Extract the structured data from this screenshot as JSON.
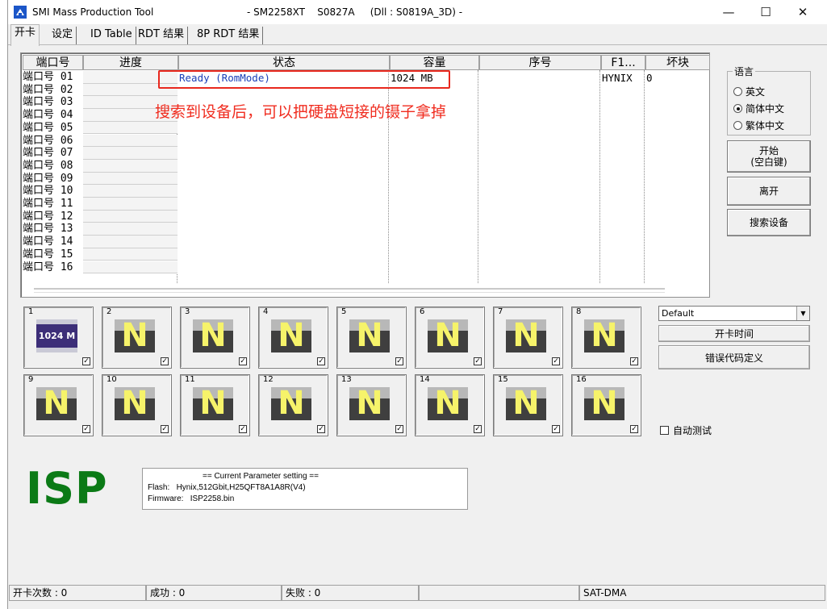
{
  "window": {
    "title": "SMI Mass Production Tool",
    "title_mid": "- SM2258XT    S0827A     (Dll : S0819A_3D) -",
    "minimize_glyph": "—",
    "maximize_glyph": "☐",
    "close_glyph": "✕"
  },
  "tabs": [
    "开卡",
    "设定",
    "ID Table",
    "RDT 结果",
    "8P RDT 结果"
  ],
  "list": {
    "headers": [
      "端口号",
      "进度",
      "状态",
      "容量",
      "序号",
      "F1...",
      "坏块"
    ],
    "ports": [
      "端口号 01",
      "端口号 02",
      "端口号 03",
      "端口号 04",
      "端口号 05",
      "端口号 06",
      "端口号 07",
      "端口号 08",
      "端口号 09",
      "端口号 10",
      "端口号 11",
      "端口号 12",
      "端口号 13",
      "端口号 14",
      "端口号 15",
      "端口号 16"
    ],
    "row1": {
      "status": "Ready (RomMode)",
      "capacity": "1024 MB",
      "flash": "HYNIX",
      "bad_blocks": "0"
    }
  },
  "annotation": "搜索到设备后，可以把硬盘短接的镊子拿掉",
  "language": {
    "title": "语言",
    "options": [
      "英文",
      "简体中文",
      "繁体中文"
    ],
    "selected": "简体中文"
  },
  "buttons": {
    "start_line1": "开始",
    "start_line2": "(空白键)",
    "exit": "离开",
    "search": "搜索设备",
    "card_time": "开卡时间",
    "error_def": "错误代码定义",
    "combo_value": "Default",
    "auto_test": "自动测试"
  },
  "slots": {
    "numbers": [
      "1",
      "2",
      "3",
      "4",
      "5",
      "6",
      "7",
      "8",
      "9",
      "10",
      "11",
      "12",
      "13",
      "14",
      "15",
      "16"
    ],
    "slot1_capacity": "1024 M",
    "empty_letter": "N"
  },
  "isp": "ISP",
  "params": {
    "header": "== Current Parameter setting ==",
    "flash": "Flash:   Hynix,512Gbit,H25QFT8A1A8R(V4)",
    "firmware": "Firmware:   ISP2258.bin"
  },
  "status_bar": {
    "count": "开卡次数 : 0",
    "success": "成功 : 0",
    "fail": "失败 : 0",
    "mode": "SAT-DMA"
  }
}
